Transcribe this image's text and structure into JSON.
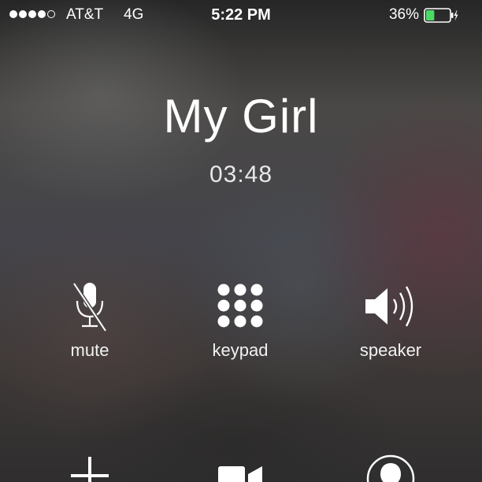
{
  "status_bar": {
    "carrier": "AT&T",
    "network": "4G",
    "time": "5:22 PM",
    "battery_percent": "36%",
    "battery_level": 0.36,
    "battery_color": "#4cd964",
    "signal_bars_filled": 4,
    "signal_bars_total": 5,
    "charging_icon": "bolt-icon"
  },
  "call": {
    "caller_name": "My Girl",
    "duration": "03:48"
  },
  "controls": {
    "mute": {
      "label": "mute",
      "icon": "microphone-off-icon"
    },
    "keypad": {
      "label": "keypad",
      "icon": "keypad-grid-icon"
    },
    "speaker": {
      "label": "speaker",
      "icon": "speaker-icon"
    },
    "add_call": {
      "icon": "plus-icon"
    },
    "facetime": {
      "icon": "video-camera-icon"
    },
    "contacts": {
      "icon": "contact-silhouette-icon"
    }
  }
}
